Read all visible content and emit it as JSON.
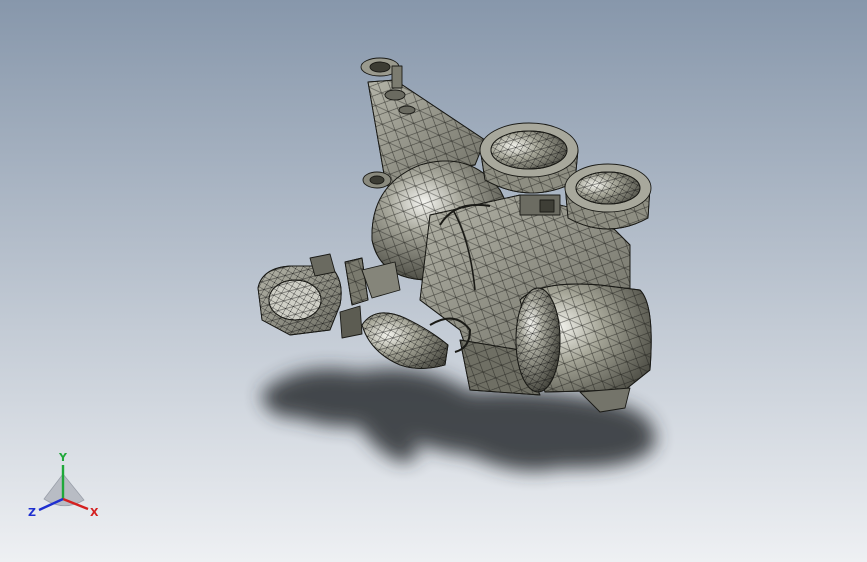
{
  "viewport": {
    "background_top": "#8797ab",
    "background_bottom": "#eef0f3",
    "model_fill": "#8a8a7e",
    "model_shade": "#4a4a42",
    "model_highlight": "#f4f4f0",
    "mesh_stroke": "#1a1a16",
    "shadow_color": "#2c2e33"
  },
  "triad": {
    "x_label": "X",
    "y_label": "Y",
    "z_label": "Z",
    "x_color": "#d42020",
    "y_color": "#1fa83a",
    "z_color": "#1e2fd0"
  }
}
